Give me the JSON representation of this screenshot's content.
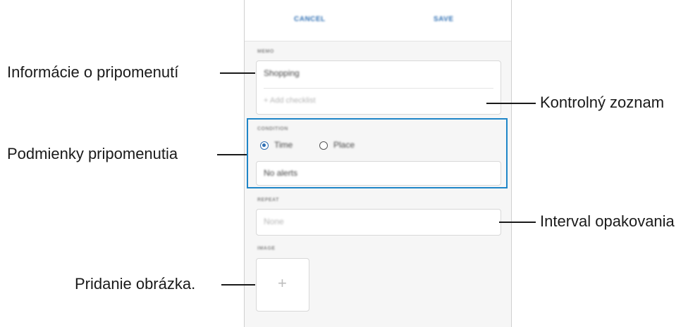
{
  "form": {
    "cancel_label": "CANCEL",
    "save_label": "SAVE",
    "memo_label": "MEMO",
    "memo_value": "Shopping",
    "add_checklist_label": "Add checklist",
    "condition_label": "CONDITION",
    "option_time": "Time",
    "option_place": "Place",
    "alerts_value": "No alerts",
    "repeat_label": "REPEAT",
    "repeat_value": "None",
    "image_label": "IMAGE",
    "add_image_symbol": "+"
  },
  "callouts": {
    "reminder_info": "Informácie o pripomenutí",
    "checklist": "Kontrolný zoznam",
    "conditions": "Podmienky pripomenutia",
    "repeat_interval": "Interval opakovania",
    "add_image": "Pridanie obrázka."
  },
  "colors": {
    "accent": "#2f6fb3",
    "highlight": "#1f86c8"
  }
}
